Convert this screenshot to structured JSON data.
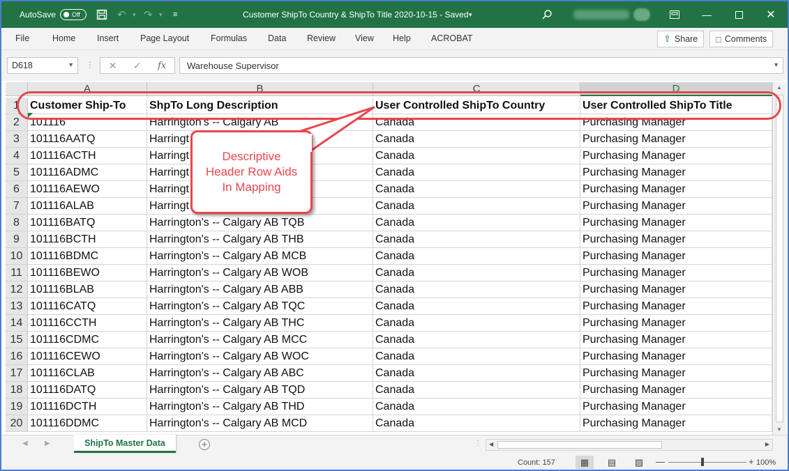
{
  "titlebar": {
    "autosave_label": "AutoSave",
    "autosave_state": "Off",
    "doc_title": "Customer ShipTo Country & ShipTo Title 2020-10-15  -  Saved",
    "save_icon": "save-icon",
    "search_icon": "search-icon"
  },
  "ribbon": {
    "tabs": [
      "File",
      "Home",
      "Insert",
      "Page Layout",
      "Formulas",
      "Data",
      "Review",
      "View",
      "Help",
      "ACROBAT"
    ],
    "share_label": "Share",
    "comments_label": "Comments"
  },
  "formula_bar": {
    "name_box": "D618",
    "fx": "fx",
    "value": "Warehouse Supervisor"
  },
  "columns": [
    "A",
    "B",
    "C",
    "D"
  ],
  "header_row": {
    "row": "1",
    "cells": [
      "Customer Ship-To",
      "ShpTo Long Description",
      "User Controlled ShipTo Country",
      "User Controlled ShipTo Title"
    ]
  },
  "rows": [
    {
      "n": "2",
      "cells": [
        "101116",
        "Harrington's -- Calgary AB",
        "Canada",
        "Purchasing Manager"
      ]
    },
    {
      "n": "3",
      "cells": [
        "101116AATQ",
        "Harringt",
        "Canada",
        "Purchasing Manager"
      ]
    },
    {
      "n": "4",
      "cells": [
        "101116ACTH",
        "Harringt",
        "Canada",
        "Purchasing Manager"
      ]
    },
    {
      "n": "5",
      "cells": [
        "101116ADMC",
        "Harringt",
        "Canada",
        "Purchasing Manager"
      ]
    },
    {
      "n": "6",
      "cells": [
        "101116AEWO",
        "Harringt",
        "Canada",
        "Purchasing Manager"
      ]
    },
    {
      "n": "7",
      "cells": [
        "101116ALAB",
        "Harringt",
        "Canada",
        "Purchasing Manager"
      ]
    },
    {
      "n": "8",
      "cells": [
        "101116BATQ",
        "Harrington's -- Calgary AB TQB",
        "Canada",
        "Purchasing Manager"
      ]
    },
    {
      "n": "9",
      "cells": [
        "101116BCTH",
        "Harrington's -- Calgary AB THB",
        "Canada",
        "Purchasing Manager"
      ]
    },
    {
      "n": "10",
      "cells": [
        "101116BDMC",
        "Harrington's -- Calgary AB MCB",
        "Canada",
        "Purchasing Manager"
      ]
    },
    {
      "n": "11",
      "cells": [
        "101116BEWO",
        "Harrington's -- Calgary AB WOB",
        "Canada",
        "Purchasing Manager"
      ]
    },
    {
      "n": "12",
      "cells": [
        "101116BLAB",
        "Harrington's -- Calgary AB ABB",
        "Canada",
        "Purchasing Manager"
      ]
    },
    {
      "n": "13",
      "cells": [
        "101116CATQ",
        "Harrington's -- Calgary AB TQC",
        "Canada",
        "Purchasing Manager"
      ]
    },
    {
      "n": "14",
      "cells": [
        "101116CCTH",
        "Harrington's -- Calgary AB THC",
        "Canada",
        "Purchasing Manager"
      ]
    },
    {
      "n": "15",
      "cells": [
        "101116CDMC",
        "Harrington's -- Calgary AB MCC",
        "Canada",
        "Purchasing Manager"
      ]
    },
    {
      "n": "16",
      "cells": [
        "101116CEWO",
        "Harrington's -- Calgary AB WOC",
        "Canada",
        "Purchasing Manager"
      ]
    },
    {
      "n": "17",
      "cells": [
        "101116CLAB",
        "Harrington's -- Calgary AB ABC",
        "Canada",
        "Purchasing Manager"
      ]
    },
    {
      "n": "18",
      "cells": [
        "101116DATQ",
        "Harrington's -- Calgary AB TQD",
        "Canada",
        "Purchasing Manager"
      ]
    },
    {
      "n": "19",
      "cells": [
        "101116DCTH",
        "Harrington's -- Calgary AB THD",
        "Canada",
        "Purchasing Manager"
      ]
    },
    {
      "n": "20",
      "cells": [
        "101116DDMC",
        "Harrington's -- Calgary AB MCD",
        "Canada",
        "Purchasing Manager"
      ]
    }
  ],
  "callout": {
    "lines": [
      "Descriptive",
      "Header Row Aids",
      "In Mapping"
    ],
    "color": "#e8474b"
  },
  "sheet_tabs": {
    "active": "ShipTo Master Data"
  },
  "status": {
    "count": "Count: 157",
    "zoom": "100%"
  },
  "colors": {
    "excel_green": "#217346"
  }
}
